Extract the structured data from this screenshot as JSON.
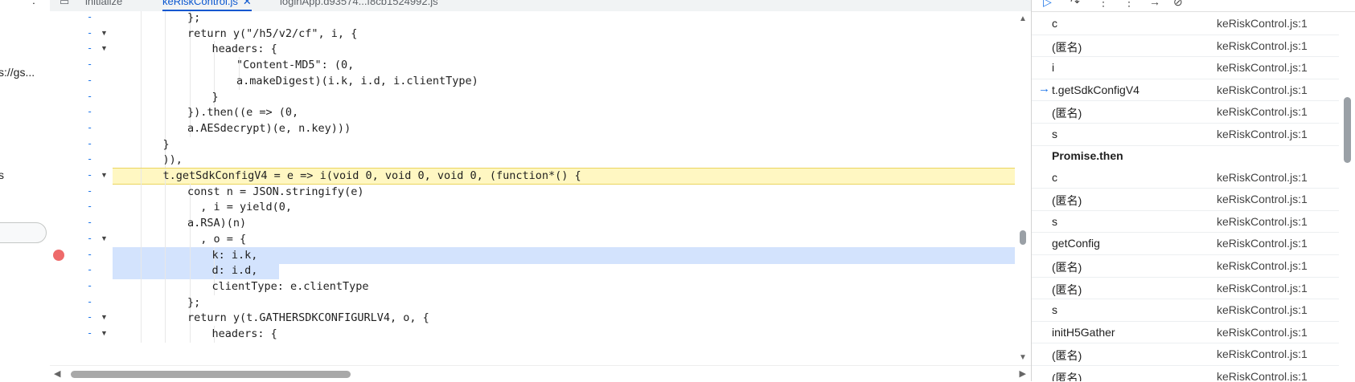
{
  "left_strip": {
    "fragment_top": ":",
    "url_fragment": "s://gs...",
    "letter_fragment": "s"
  },
  "tabs": [
    {
      "label": "initialize",
      "active": false
    },
    {
      "label": "keRiskControl.js",
      "active": true,
      "close": "✕"
    },
    {
      "label": "loginApp.d93574...f8cb1524992.js",
      "active": false
    }
  ],
  "code_lines": [
    {
      "id": 0,
      "indent": 4,
      "text": "};"
    },
    {
      "id": 1,
      "indent": 4,
      "text": "return y(\"/h5/v2/cf\", i, {"
    },
    {
      "id": 2,
      "indent": 5,
      "text": "headers: {"
    },
    {
      "id": 3,
      "indent": 6,
      "text": "\"Content-MD5\": (0,"
    },
    {
      "id": 4,
      "indent": 6,
      "text": "a.makeDigest)(i.k, i.d, i.clientType)"
    },
    {
      "id": 5,
      "indent": 5,
      "text": "}"
    },
    {
      "id": 6,
      "indent": 4,
      "text": "}).then((e => (0,"
    },
    {
      "id": 7,
      "indent": 4,
      "text": "a.AESdecrypt)(e, n.key)))"
    },
    {
      "id": 8,
      "indent": 3,
      "text": "}"
    },
    {
      "id": 9,
      "indent": 3,
      "text": ")),"
    },
    {
      "id": 10,
      "indent": 3,
      "text": "t.getSdkConfigV4 = e => i(void 0, void 0, void 0, (function*() {"
    },
    {
      "id": 11,
      "indent": 4,
      "text": "const n = JSON.stringify(e)"
    },
    {
      "id": 12,
      "indent": 4,
      "text": "  , i = yield(0,"
    },
    {
      "id": 13,
      "indent": 4,
      "text": "a.RSA)(n)"
    },
    {
      "id": 14,
      "indent": 4,
      "text": "  , o = {"
    },
    {
      "id": 15,
      "indent": 5,
      "text": "k: i.k,"
    },
    {
      "id": 16,
      "indent": 5,
      "text": "d: i.d,"
    },
    {
      "id": 17,
      "indent": 5,
      "text": "clientType: e.clientType"
    },
    {
      "id": 18,
      "indent": 4,
      "text": "};"
    },
    {
      "id": 19,
      "indent": 4,
      "text": "return y(t.GATHERSDKCONFIGURLV4, o, {"
    },
    {
      "id": 20,
      "indent": 5,
      "text": "headers: {"
    }
  ],
  "gutter_marks": "-",
  "fold_icon": "▼",
  "call_stack": [
    {
      "name": "c",
      "location": "keRiskControl.js:1"
    },
    {
      "name": "(匿名)",
      "location": "keRiskControl.js:1"
    },
    {
      "name": "i",
      "location": "keRiskControl.js:1"
    },
    {
      "name": "t.getSdkConfigV4",
      "location": "keRiskControl.js:1",
      "current": true
    },
    {
      "name": "(匿名)",
      "location": "keRiskControl.js:1"
    },
    {
      "name": "s",
      "location": "keRiskControl.js:1"
    },
    {
      "name": "Promise.then",
      "section": true
    },
    {
      "name": "c",
      "location": "keRiskControl.js:1"
    },
    {
      "name": "(匿名)",
      "location": "keRiskControl.js:1"
    },
    {
      "name": "s",
      "location": "keRiskControl.js:1"
    },
    {
      "name": "getConfig",
      "location": "keRiskControl.js:1"
    },
    {
      "name": "(匿名)",
      "location": "keRiskControl.js:1"
    },
    {
      "name": "(匿名)",
      "location": "keRiskControl.js:1"
    },
    {
      "name": "s",
      "location": "keRiskControl.js:1"
    },
    {
      "name": "initH5Gather",
      "location": "keRiskControl.js:1"
    },
    {
      "name": "(匿名)",
      "location": "keRiskControl.js:1"
    },
    {
      "name": "(匿名)",
      "location": "keRiskControl.js:1"
    }
  ],
  "icons": {
    "resume": "resume-icon",
    "step_over": "step-over-icon",
    "step_into": "step-into-icon",
    "step_out": "step-out-icon",
    "step": "step-icon",
    "deactivate": "deactivate-breakpoints-icon"
  },
  "colors": {
    "exec_line": "#fff7c2",
    "selection": "#d3e3fd",
    "accent": "#0b57d0",
    "breakpoint": "#ee6a6a"
  }
}
